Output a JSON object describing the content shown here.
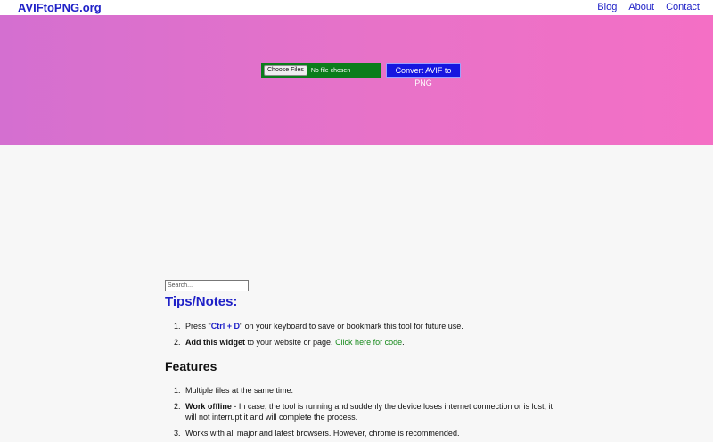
{
  "header": {
    "brand": "AVIFtoPNG.org",
    "nav": [
      "Blog",
      "About",
      "Contact"
    ]
  },
  "upload": {
    "choose_label": "Choose Files",
    "file_status": "No file chosen",
    "convert_label": "Convert AVIF to PNG"
  },
  "search": {
    "placeholder": "Search..."
  },
  "tips": {
    "title": "Tips/Notes:",
    "item1": {
      "num": "1.",
      "before": "Press \"",
      "key": "Ctrl + D",
      "after": "\" on your keyboard to save or bookmark this tool for future use."
    },
    "item2": {
      "num": "2.",
      "bold": "Add this widget",
      "middle": " to your website or page. ",
      "link": "Click here for code",
      "end": "."
    }
  },
  "features": {
    "title": "Features",
    "item1": {
      "num": "1.",
      "text": "Multiple files at the same time."
    },
    "item2": {
      "num": "2.",
      "bold": "Work offline",
      "text": " - In case, the tool is running and suddenly the device loses internet connection or is lost, it will not interrupt it and will complete the process."
    },
    "item3": {
      "num": "3.",
      "text": "Works with all major and latest browsers. However, chrome is recommended."
    }
  },
  "colors": {
    "brand_blue": "#1f21c7",
    "hero_start": "#d46fd0",
    "hero_end": "#f46fc5",
    "file_box": "#0b7d1b",
    "convert_button": "#1616e0",
    "link_green": "#178a1c"
  }
}
